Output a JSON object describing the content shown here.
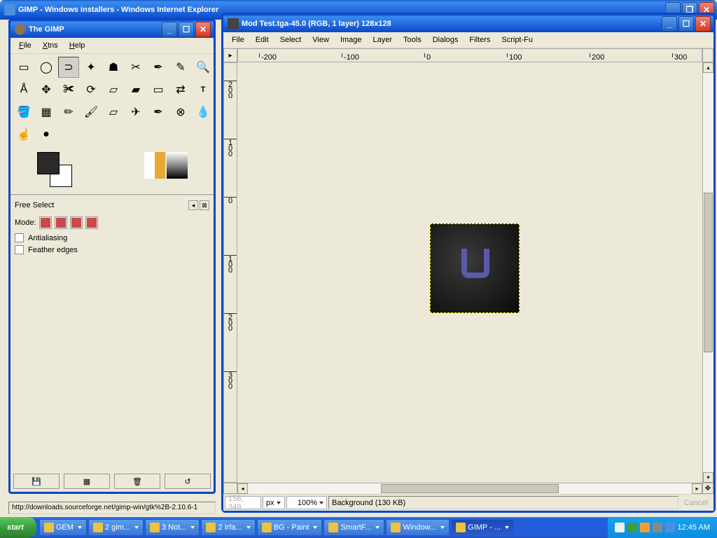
{
  "ie": {
    "title": "GIMP - Windows installers - Windows Internet Explorer"
  },
  "toolbox": {
    "title": "The GIMP",
    "menu": [
      "File",
      "Xtns",
      "Help"
    ],
    "options_title": "Free Select",
    "mode_label": "Mode:",
    "antialiasing": "Antialiasing",
    "feather": "Feather edges"
  },
  "image_window": {
    "title": "Mod Test.tga-45.0 (RGB, 1 layer) 128x128",
    "menu": [
      "File",
      "Edit",
      "Select",
      "View",
      "Image",
      "Layer",
      "Tools",
      "Dialogs",
      "Filters",
      "Script-Fu"
    ],
    "h_ticks": [
      {
        "pos": 30,
        "label": "-200"
      },
      {
        "pos": 148,
        "label": "-100"
      },
      {
        "pos": 266,
        "label": "0"
      },
      {
        "pos": 384,
        "label": "100"
      },
      {
        "pos": 502,
        "label": "200"
      },
      {
        "pos": 620,
        "label": "300"
      }
    ],
    "v_ticks": [
      {
        "pos": 25,
        "label": "200"
      },
      {
        "pos": 108,
        "label": "100"
      },
      {
        "pos": 191,
        "label": "0"
      },
      {
        "pos": 274,
        "label": "100"
      },
      {
        "pos": 357,
        "label": "200"
      },
      {
        "pos": 440,
        "label": "300"
      }
    ],
    "status": {
      "coord": "158, 349",
      "unit": "px",
      "zoom": "100%",
      "info": "Background (130 KB)",
      "cancel": "Cancel"
    }
  },
  "url": "http://downloads.sourceforge.net/gimp-win/gtk%2B-2.10.6-1",
  "taskbar": {
    "start": "start",
    "items": [
      {
        "label": "GEM"
      },
      {
        "label": "2 gim..."
      },
      {
        "label": "3 Not..."
      },
      {
        "label": "2 Irfa..."
      },
      {
        "label": "BG - Paint"
      },
      {
        "label": "SmartF..."
      },
      {
        "label": "Window..."
      },
      {
        "label": "GIMP - ..."
      }
    ],
    "clock": "12:45 AM"
  }
}
